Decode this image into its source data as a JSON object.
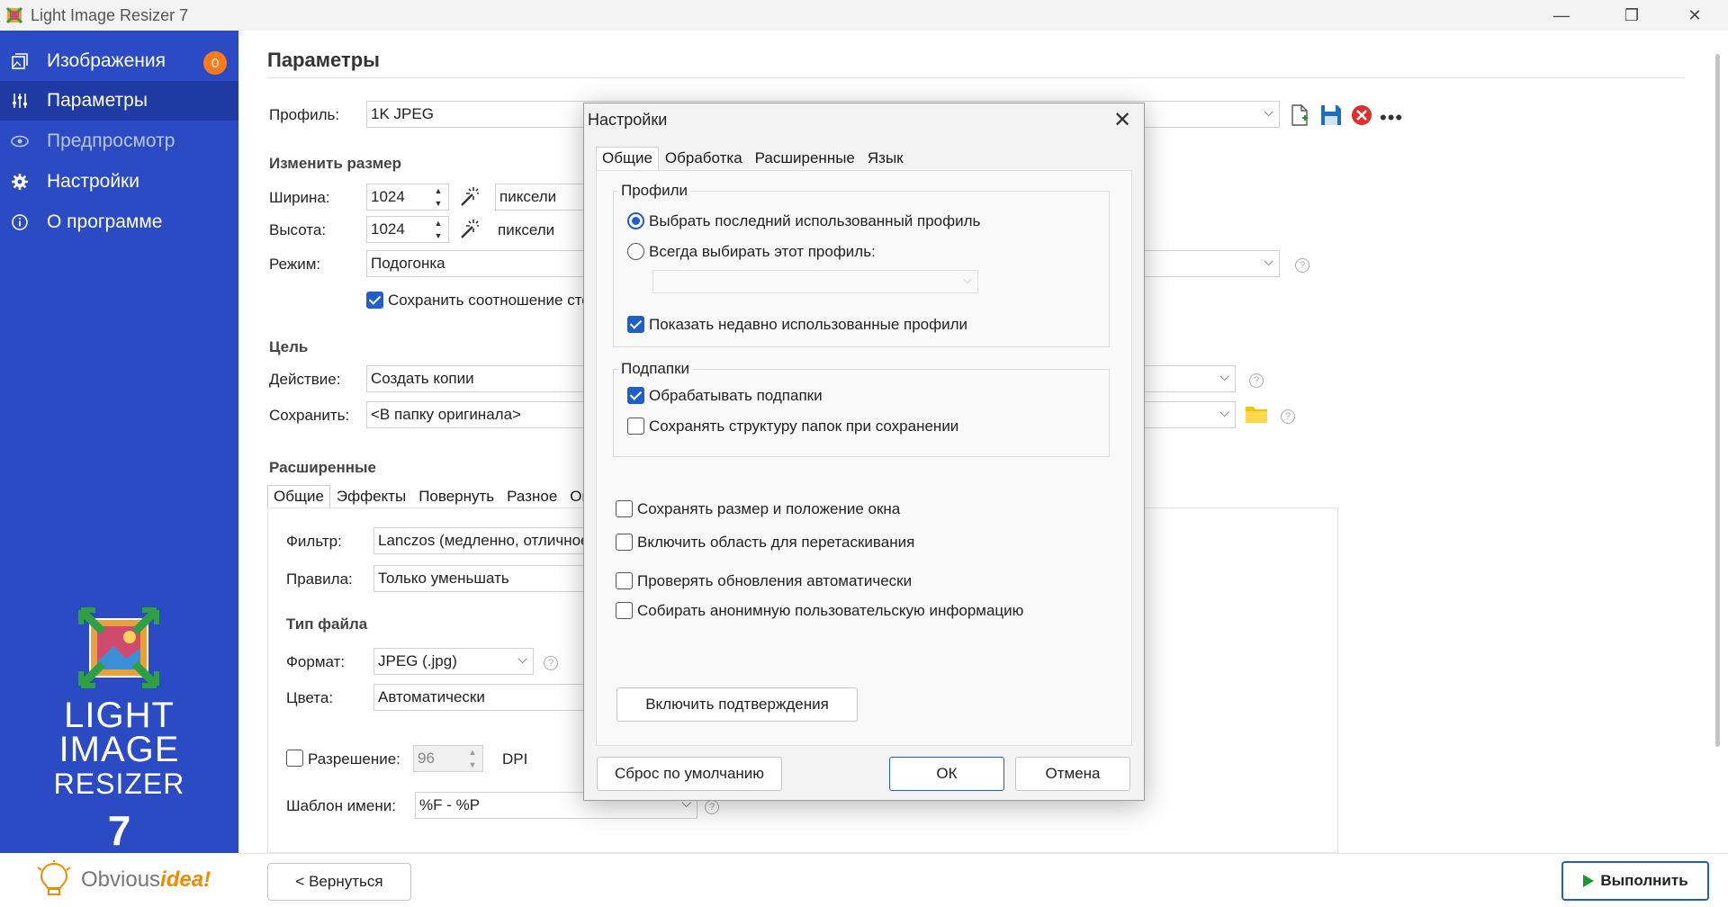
{
  "window": {
    "title": "Light Image Resizer 7",
    "controls": {
      "minimize": "—",
      "maximize": "❐",
      "close": "✕"
    }
  },
  "sidebar": {
    "items": [
      {
        "label": "Изображения",
        "icon": "images-icon",
        "badge": "0"
      },
      {
        "label": "Параметры",
        "icon": "sliders-icon"
      },
      {
        "label": "Предпросмотр",
        "icon": "eye-icon"
      },
      {
        "label": "Настройки",
        "icon": "gear-icon"
      },
      {
        "label": "О программе",
        "icon": "info-icon"
      }
    ],
    "brand": {
      "line1": "LIGHT",
      "line2": "IMAGE",
      "line3": "RESIZER",
      "version": "7"
    },
    "company": {
      "part1": "Obvious",
      "part2": "idea!"
    }
  },
  "main": {
    "title": "Параметры",
    "profile": {
      "label": "Профиль:",
      "value": "1K JPEG"
    },
    "resize": {
      "section": "Изменить размер",
      "width_label": "Ширина:",
      "width_value": "1024",
      "width_unit": "пиксели",
      "height_label": "Высота:",
      "height_value": "1024",
      "height_unit": "пиксели",
      "mode_label": "Режим:",
      "mode_value": "Подогонка",
      "keep_ratio": "Сохранить соотношение стор"
    },
    "target": {
      "section": "Цель",
      "action_label": "Действие:",
      "action_value": "Создать копии",
      "save_label": "Сохранить:",
      "save_value": "<В папку оригинала>"
    },
    "advanced": {
      "section": "Расширенные",
      "tabs": [
        "Общие",
        "Эффекты",
        "Повернуть",
        "Разное",
        "Оптим"
      ],
      "filter_label": "Фильтр:",
      "filter_value": "Lanczos  (медленно, отличное",
      "rules_label": "Правила:",
      "rules_value": "Только уменьшать",
      "filetype_section": "Тип файла",
      "format_label": "Формат:",
      "format_value": "JPEG (.jpg)",
      "colors_label": "Цвета:",
      "colors_value": "Автоматически",
      "resolution_label": "Разрешение:",
      "resolution_value": "96",
      "resolution_unit": "DPI",
      "template_label": "Шаблон имени:",
      "template_value": "%F - %P"
    },
    "back_button": "< Вернуться",
    "run_button": "Выполнить"
  },
  "dialog": {
    "title": "Настройки",
    "tabs": [
      "Общие",
      "Обработка",
      "Расширенные",
      "Язык"
    ],
    "profiles_group": "Профили",
    "radio_last": "Выбрать последний использованный профиль",
    "radio_always": "Всегда выбирать этот профиль:",
    "show_recent": "Показать недавно использованные профили",
    "subfolders_group": "Подпапки",
    "process_subfolders": "Обрабатывать подпапки",
    "keep_structure": "Сохранять структуру папок при сохранении",
    "save_window": "Сохранять размер и положение окна",
    "drop_area": "Включить область для перетаскивания",
    "check_updates": "Проверять обновления автоматически",
    "collect_info": "Собирать анонимную пользовательскую информацию",
    "enable_confirm": "Включить подтверждения",
    "reset": "Сброс по умолчанию",
    "ok": "ОК",
    "cancel": "Отмена"
  },
  "colors": {
    "sidebar": "#2a4bc4",
    "sidebar_active": "#1f3aa3",
    "accent": "#1e5fc9",
    "badge": "#ff7a1a",
    "run_icon": "#1a9a2a"
  }
}
